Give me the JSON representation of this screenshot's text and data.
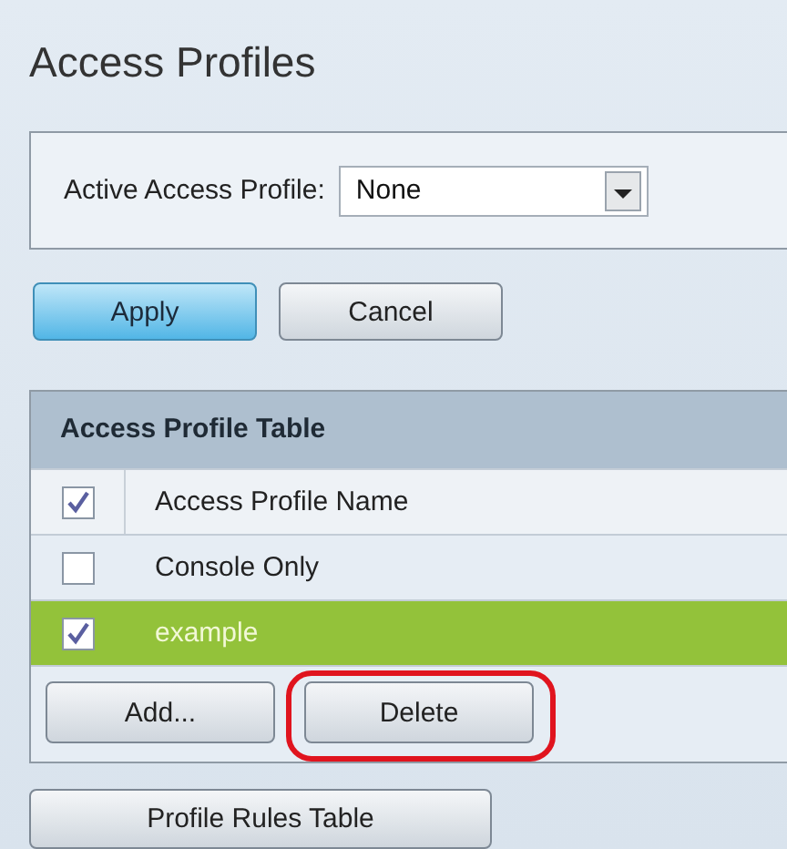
{
  "page": {
    "title": "Access Profiles"
  },
  "settings": {
    "label": "Active Access Profile:",
    "select_value": "None"
  },
  "form_buttons": [
    {
      "label": "Apply",
      "primary": true
    },
    {
      "label": "Cancel",
      "primary": false
    }
  ],
  "table": {
    "title": "Access Profile Table",
    "header": {
      "label": "Access Profile Name",
      "checked": true
    },
    "rows": [
      {
        "name": "Console Only",
        "checked": false,
        "selected": false
      },
      {
        "name": "example",
        "checked": true,
        "selected": true
      }
    ],
    "buttons": [
      {
        "label": "Add...",
        "circled": false
      },
      {
        "label": "Delete",
        "circled": true
      }
    ]
  },
  "footer_button": {
    "label": "Profile Rules Table"
  }
}
